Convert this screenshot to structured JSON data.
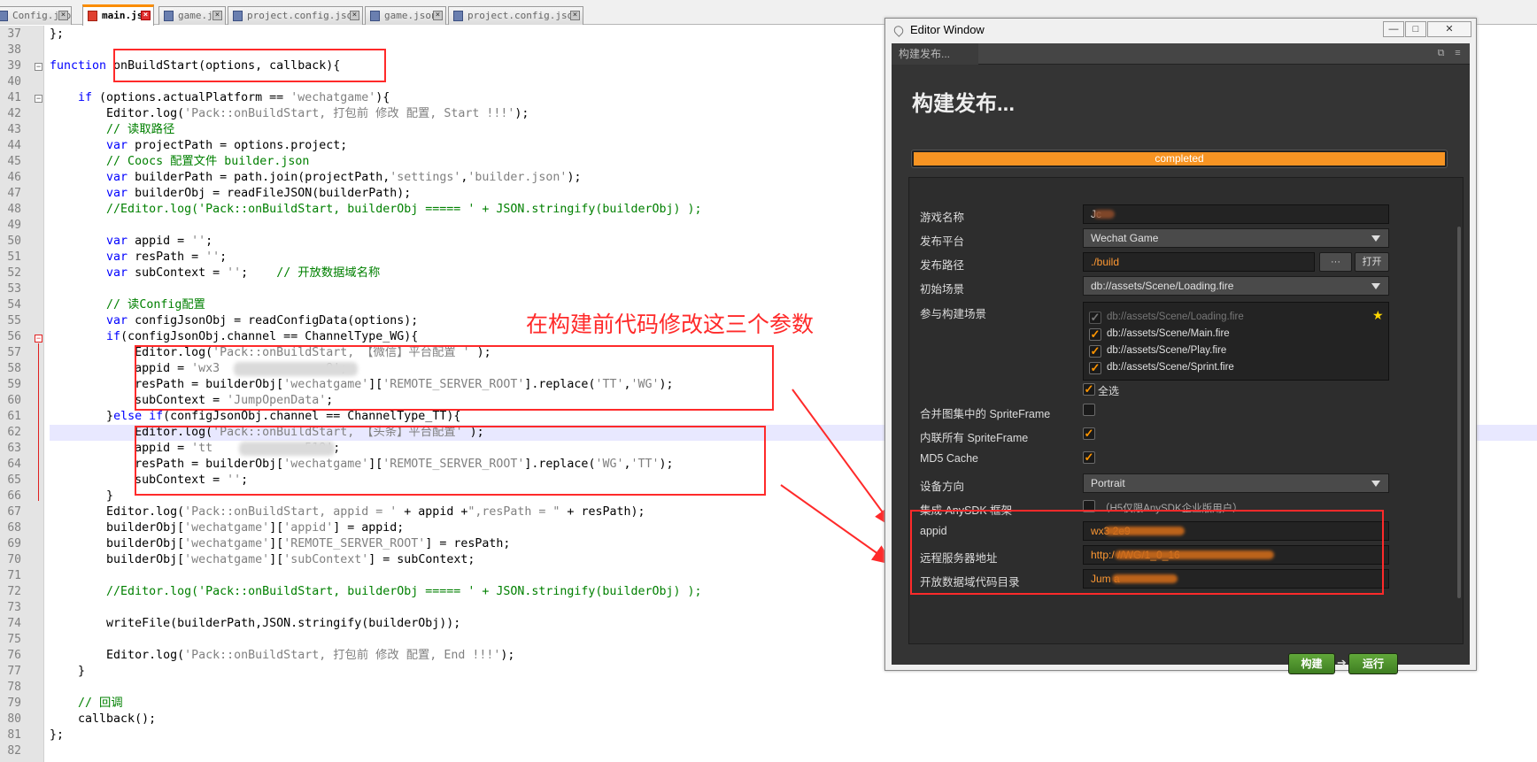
{
  "tabs": [
    {
      "label": "Config.json",
      "active": false
    },
    {
      "label": "main.js",
      "active": true
    },
    {
      "label": "game.js",
      "active": false
    },
    {
      "label": "project.config.json",
      "active": false
    },
    {
      "label": "game.json",
      "active": false
    },
    {
      "label": "project.config.json",
      "active": false
    }
  ],
  "editor": {
    "highlighted_line": 62,
    "lines": [
      {
        "n": "37",
        "t": [
          {
            "c": "t",
            "s": "};"
          }
        ]
      },
      {
        "n": "38",
        "t": []
      },
      {
        "n": "39",
        "t": [
          {
            "c": "kw",
            "s": "function"
          },
          {
            "c": "t",
            "s": " onBuildStart(options, callback){"
          }
        ]
      },
      {
        "n": "40",
        "t": []
      },
      {
        "n": "41",
        "t": [
          {
            "c": "t",
            "s": "    "
          },
          {
            "c": "kw",
            "s": "if"
          },
          {
            "c": "t",
            "s": " (options.actualPlatform == "
          },
          {
            "c": "str",
            "s": "'wechatgame'"
          },
          {
            "c": "t",
            "s": "){"
          }
        ]
      },
      {
        "n": "42",
        "t": [
          {
            "c": "t",
            "s": "        Editor.log("
          },
          {
            "c": "str",
            "s": "'Pack::onBuildStart, 打包前 修改 配置, Start !!!'"
          },
          {
            "c": "t",
            "s": ");"
          }
        ]
      },
      {
        "n": "43",
        "t": [
          {
            "c": "com",
            "s": "        // 读取路径"
          }
        ]
      },
      {
        "n": "44",
        "t": [
          {
            "c": "t",
            "s": "        "
          },
          {
            "c": "kw",
            "s": "var"
          },
          {
            "c": "t",
            "s": " projectPath = options.project;"
          }
        ]
      },
      {
        "n": "45",
        "t": [
          {
            "c": "com",
            "s": "        // Coocs 配置文件 builder.json"
          }
        ]
      },
      {
        "n": "46",
        "t": [
          {
            "c": "t",
            "s": "        "
          },
          {
            "c": "kw",
            "s": "var"
          },
          {
            "c": "t",
            "s": " builderPath = path.join(projectPath,"
          },
          {
            "c": "str",
            "s": "'settings'"
          },
          {
            "c": "t",
            "s": ","
          },
          {
            "c": "str",
            "s": "'builder.json'"
          },
          {
            "c": "t",
            "s": ");"
          }
        ]
      },
      {
        "n": "47",
        "t": [
          {
            "c": "t",
            "s": "        "
          },
          {
            "c": "kw",
            "s": "var"
          },
          {
            "c": "t",
            "s": " builderObj = readFileJSON(builderPath);"
          }
        ]
      },
      {
        "n": "48",
        "t": [
          {
            "c": "com",
            "s": "        //Editor.log('Pack::onBuildStart, builderObj ===== ' + JSON.stringify(builderObj) );"
          }
        ]
      },
      {
        "n": "49",
        "t": []
      },
      {
        "n": "50",
        "t": [
          {
            "c": "t",
            "s": "        "
          },
          {
            "c": "kw",
            "s": "var"
          },
          {
            "c": "t",
            "s": " appid = "
          },
          {
            "c": "str",
            "s": "''"
          },
          {
            "c": "t",
            "s": ";"
          }
        ]
      },
      {
        "n": "51",
        "t": [
          {
            "c": "t",
            "s": "        "
          },
          {
            "c": "kw",
            "s": "var"
          },
          {
            "c": "t",
            "s": " resPath = "
          },
          {
            "c": "str",
            "s": "''"
          },
          {
            "c": "t",
            "s": ";"
          }
        ]
      },
      {
        "n": "52",
        "t": [
          {
            "c": "t",
            "s": "        "
          },
          {
            "c": "kw",
            "s": "var"
          },
          {
            "c": "t",
            "s": " subContext = "
          },
          {
            "c": "str",
            "s": "''"
          },
          {
            "c": "t",
            "s": ";    "
          },
          {
            "c": "com",
            "s": "// 开放数据域名称"
          }
        ]
      },
      {
        "n": "53",
        "t": []
      },
      {
        "n": "54",
        "t": [
          {
            "c": "com",
            "s": "        // 读Config配置"
          }
        ]
      },
      {
        "n": "55",
        "t": [
          {
            "c": "t",
            "s": "        "
          },
          {
            "c": "kw",
            "s": "var"
          },
          {
            "c": "t",
            "s": " configJsonObj = readConfigData(options);"
          }
        ]
      },
      {
        "n": "56",
        "t": [
          {
            "c": "t",
            "s": "        "
          },
          {
            "c": "kw",
            "s": "if"
          },
          {
            "c": "t",
            "s": "(configJsonObj.channel == ChannelType_WG){"
          }
        ]
      },
      {
        "n": "57",
        "t": [
          {
            "c": "t",
            "s": "            Editor.log("
          },
          {
            "c": "str",
            "s": "'Pack::onBuildStart, 【微信】平台配置 '"
          },
          {
            "c": "t",
            "s": " );"
          }
        ]
      },
      {
        "n": "58",
        "t": [
          {
            "c": "t",
            "s": "            appid = "
          },
          {
            "c": "str",
            "s": "'wx3               9'"
          },
          {
            "c": "t",
            "s": ";"
          }
        ]
      },
      {
        "n": "59",
        "t": [
          {
            "c": "t",
            "s": "            resPath = builderObj["
          },
          {
            "c": "str",
            "s": "'wechatgame'"
          },
          {
            "c": "t",
            "s": "]["
          },
          {
            "c": "str",
            "s": "'REMOTE_SERVER_ROOT'"
          },
          {
            "c": "t",
            "s": "].replace("
          },
          {
            "c": "str",
            "s": "'TT'"
          },
          {
            "c": "t",
            "s": ","
          },
          {
            "c": "str",
            "s": "'WG'"
          },
          {
            "c": "t",
            "s": ");"
          }
        ]
      },
      {
        "n": "60",
        "t": [
          {
            "c": "t",
            "s": "            subContext = "
          },
          {
            "c": "str",
            "s": "'JumpOpenData'"
          },
          {
            "c": "t",
            "s": ";"
          }
        ]
      },
      {
        "n": "61",
        "t": [
          {
            "c": "t",
            "s": "        }"
          },
          {
            "c": "kw",
            "s": "else if"
          },
          {
            "c": "t",
            "s": "(configJsonObj.channel == ChannelType_TT){"
          }
        ]
      },
      {
        "n": "62",
        "t": [
          {
            "c": "t",
            "s": "            Editor.log("
          },
          {
            "c": "str",
            "s": "'Pack::onBuildStart, 【头条】平台配置'"
          },
          {
            "c": "t",
            "s": " );"
          }
        ]
      },
      {
        "n": "63",
        "t": [
          {
            "c": "t",
            "s": "            appid = "
          },
          {
            "c": "str",
            "s": "'tt             519'"
          },
          {
            "c": "t",
            "s": ";"
          }
        ]
      },
      {
        "n": "64",
        "t": [
          {
            "c": "t",
            "s": "            resPath = builderObj["
          },
          {
            "c": "str",
            "s": "'wechatgame'"
          },
          {
            "c": "t",
            "s": "]["
          },
          {
            "c": "str",
            "s": "'REMOTE_SERVER_ROOT'"
          },
          {
            "c": "t",
            "s": "].replace("
          },
          {
            "c": "str",
            "s": "'WG'"
          },
          {
            "c": "t",
            "s": ","
          },
          {
            "c": "str",
            "s": "'TT'"
          },
          {
            "c": "t",
            "s": ");"
          }
        ]
      },
      {
        "n": "65",
        "t": [
          {
            "c": "t",
            "s": "            subContext = "
          },
          {
            "c": "str",
            "s": "''"
          },
          {
            "c": "t",
            "s": ";"
          }
        ]
      },
      {
        "n": "66",
        "t": [
          {
            "c": "t",
            "s": "        }"
          }
        ]
      },
      {
        "n": "67",
        "t": [
          {
            "c": "t",
            "s": "        Editor.log("
          },
          {
            "c": "str",
            "s": "'Pack::onBuildStart, appid = '"
          },
          {
            "c": "t",
            "s": " + appid +"
          },
          {
            "c": "str",
            "s": "\",resPath = \""
          },
          {
            "c": "t",
            "s": " + resPath);"
          }
        ]
      },
      {
        "n": "68",
        "t": [
          {
            "c": "t",
            "s": "        builderObj["
          },
          {
            "c": "str",
            "s": "'wechatgame'"
          },
          {
            "c": "t",
            "s": "]["
          },
          {
            "c": "str",
            "s": "'appid'"
          },
          {
            "c": "t",
            "s": "] = appid;"
          }
        ]
      },
      {
        "n": "69",
        "t": [
          {
            "c": "t",
            "s": "        builderObj["
          },
          {
            "c": "str",
            "s": "'wechatgame'"
          },
          {
            "c": "t",
            "s": "]["
          },
          {
            "c": "str",
            "s": "'REMOTE_SERVER_ROOT'"
          },
          {
            "c": "t",
            "s": "] = resPath;"
          }
        ]
      },
      {
        "n": "70",
        "t": [
          {
            "c": "t",
            "s": "        builderObj["
          },
          {
            "c": "str",
            "s": "'wechatgame'"
          },
          {
            "c": "t",
            "s": "]["
          },
          {
            "c": "str",
            "s": "'subContext'"
          },
          {
            "c": "t",
            "s": "] = subContext;"
          }
        ]
      },
      {
        "n": "71",
        "t": []
      },
      {
        "n": "72",
        "t": [
          {
            "c": "com",
            "s": "        //Editor.log('Pack::onBuildStart, builderObj ===== ' + JSON.stringify(builderObj) );"
          }
        ]
      },
      {
        "n": "73",
        "t": []
      },
      {
        "n": "74",
        "t": [
          {
            "c": "t",
            "s": "        writeFile(builderPath,JSON.stringify(builderObj));"
          }
        ]
      },
      {
        "n": "75",
        "t": []
      },
      {
        "n": "76",
        "t": [
          {
            "c": "t",
            "s": "        Editor.log("
          },
          {
            "c": "str",
            "s": "'Pack::onBuildStart, 打包前 修改 配置, End !!!'"
          },
          {
            "c": "t",
            "s": ");"
          }
        ]
      },
      {
        "n": "77",
        "t": [
          {
            "c": "t",
            "s": "    }"
          }
        ]
      },
      {
        "n": "78",
        "t": []
      },
      {
        "n": "79",
        "t": [
          {
            "c": "com",
            "s": "    // 回调"
          }
        ]
      },
      {
        "n": "80",
        "t": [
          {
            "c": "t",
            "s": "    callback();"
          }
        ]
      },
      {
        "n": "81",
        "t": [
          {
            "c": "t",
            "s": "};"
          }
        ]
      },
      {
        "n": "82",
        "t": []
      }
    ]
  },
  "annotation": {
    "text": "在构建前代码修改这三个参数"
  },
  "editor_window": {
    "title": "Editor Window",
    "tab_label": "构建发布...",
    "heading": "构建发布...",
    "progress": {
      "label": "completed",
      "value": 1.0
    },
    "fields": {
      "game_name": {
        "label": "游戏名称",
        "value": "Jc"
      },
      "platform": {
        "label": "发布平台",
        "value": "Wechat Game"
      },
      "build_path": {
        "label": "发布路径",
        "value": "./build",
        "browse": "···",
        "open": "打开"
      },
      "start_scene": {
        "label": "初始场景",
        "value": "db://assets/Scene/Loading.fire"
      },
      "scenes": {
        "label": "参与构建场景",
        "items": [
          {
            "path": "db://assets/Scene/Loading.fire",
            "checked": true,
            "disabled": true
          },
          {
            "path": "db://assets/Scene/Main.fire",
            "checked": true,
            "disabled": false
          },
          {
            "path": "db://assets/Scene/Play.fire",
            "checked": true,
            "disabled": false
          },
          {
            "path": "db://assets/Scene/Sprint.fire",
            "checked": true,
            "disabled": false
          }
        ],
        "select_all": "全选"
      },
      "merge_sprite": {
        "label": "合并图集中的 SpriteFrame",
        "checked": false
      },
      "inline_sprite": {
        "label": "内联所有 SpriteFrame",
        "checked": true
      },
      "md5": {
        "label": "MD5 Cache",
        "checked": true
      },
      "orientation": {
        "label": "设备方向",
        "value": "Portrait"
      },
      "anysdk": {
        "label": "集成 AnySDK 框架",
        "note": "（H5仅限AnySDK企业版用户）",
        "checked": false
      },
      "appid": {
        "label": "appid",
        "value": "wx3                  2e9"
      },
      "remote_server": {
        "label": "远程服务器地址",
        "value": "http:/                                          //WG/1_0_16"
      },
      "open_data": {
        "label": "开放数据域代码目录",
        "value": "Jum               a"
      }
    },
    "build_button": "构建",
    "run_button": "运行"
  },
  "colors": {
    "accent": "#fa8c00",
    "annotation": "#ff2a2a",
    "keyword": "#0000ff",
    "string": "#808080",
    "comment": "#008000",
    "progress": "#f79423",
    "button_green": "#4e9a2c"
  }
}
